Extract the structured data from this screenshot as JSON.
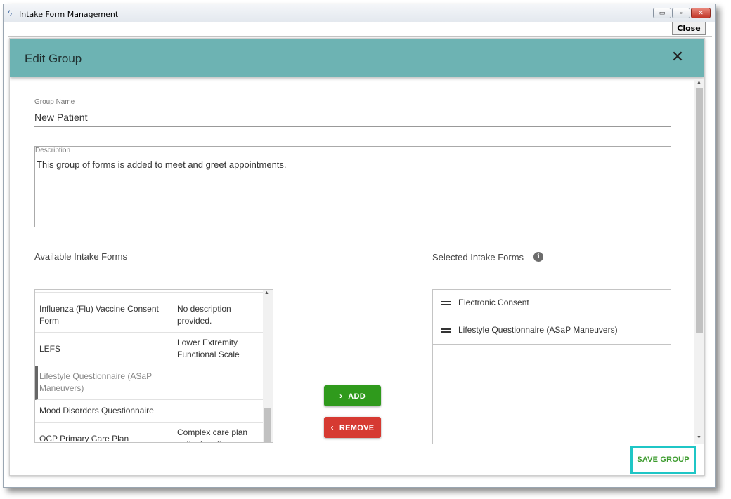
{
  "window": {
    "title": "Intake Form Management",
    "close_label": "Close"
  },
  "dialog": {
    "title": "Edit Group",
    "group_name_label": "Group Name",
    "group_name_value": "New Patient",
    "description_label": "Description",
    "description_value": "This group of forms is added to meet and greet appointments.",
    "available_label": "Available Intake Forms",
    "selected_label": "Selected Intake Forms",
    "available_forms": [
      {
        "name": "Influenza (Flu) Vaccine Consent Form",
        "description": "No description provided."
      },
      {
        "name": "LEFS",
        "description": "Lower Extremity Functional Scale"
      },
      {
        "name": "Lifestyle Questionnaire (ASaP Maneuvers)",
        "description": "",
        "selected": true
      },
      {
        "name": "Mood Disorders Questionnaire",
        "description": ""
      },
      {
        "name": "OCP Primary Care Plan",
        "description": "Complex care plan patient portion"
      }
    ],
    "selected_forms": [
      {
        "name": "Electronic Consent"
      },
      {
        "name": "Lifestyle Questionnaire (ASaP Maneuvers)"
      }
    ],
    "add_label": "ADD",
    "remove_label": "REMOVE",
    "save_label": "SAVE GROUP"
  },
  "colors": {
    "header": "#6db3b3",
    "add": "#2f9a1c",
    "remove": "#d63a32",
    "save_text": "#3c9b2e",
    "save_highlight": "#1fc6c6"
  }
}
